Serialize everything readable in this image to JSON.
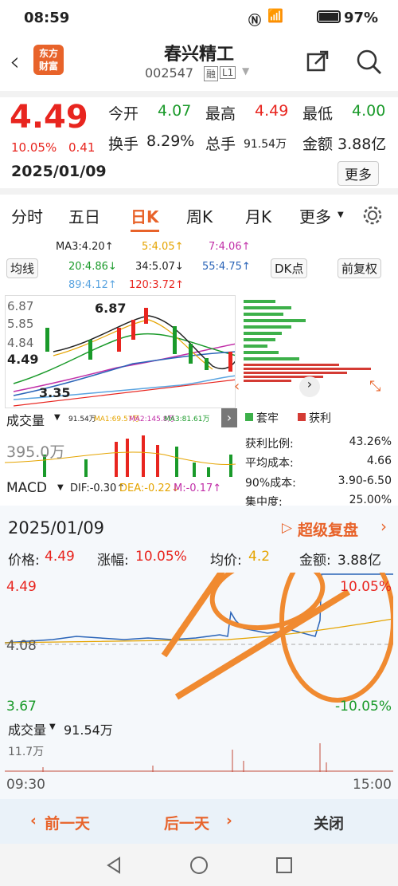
{
  "status": {
    "time": "08:59",
    "battery": "97%"
  },
  "header": {
    "title": "春兴精工",
    "code": "002547",
    "tags": [
      "融",
      "L1"
    ],
    "logo_top": "东方",
    "logo_bottom": "财富"
  },
  "quote": {
    "price": "4.49",
    "change_pct": "10.05%",
    "change": "0.41",
    "date": "2025/01/09",
    "open_label": "今开",
    "open": "4.07",
    "high_label": "最高",
    "high": "4.49",
    "low_label": "最低",
    "low": "4.00",
    "turnover_label": "换手",
    "turnover": "8.29%",
    "volume_label": "总手",
    "volume": "91.54万",
    "amount_label": "金额",
    "amount": "3.88亿",
    "more": "更多"
  },
  "tabs": [
    "分时",
    "五日",
    "日K",
    "周K",
    "月K",
    "更多"
  ],
  "ma": {
    "label": "均线",
    "ma3": "MA3:4.20↑",
    "ma5": "5:4.05↑",
    "ma7": "7:4.06↑",
    "ma20": "20:4.86↓",
    "ma34": "34:5.07↓",
    "ma55": "55:4.75↑",
    "ma89": "89:4.12↑",
    "ma120": "120:3.72↑",
    "dk": "DK点",
    "fuquan": "前复权"
  },
  "kline": {
    "high_marker": "6.87",
    "low_marker": "3.35",
    "price_tag": "4.49",
    "axis": [
      "6.87",
      "5.85",
      "4.84"
    ]
  },
  "volume_bar": {
    "label": "成交量",
    "vol": "91.54万",
    "ma1": "MA1:69.57万",
    "ma2": "MA2:145.8万",
    "ma3": "MA3:81.61万",
    "axis": "395.0万"
  },
  "macd": {
    "label": "MACD",
    "dif": "DIF:-0.30↑",
    "dea": "DEA:-0.22↓",
    "m": "M:-0.17↑"
  },
  "chips": {
    "legend_trapped": "套牢",
    "legend_profit": "获利",
    "rows": [
      {
        "label": "获利比例:",
        "value": "43.26%"
      },
      {
        "label": "平均成本:",
        "value": "4.66"
      },
      {
        "label": "90%成本:",
        "value": "3.90-6.50"
      },
      {
        "label": "集中度:",
        "value": "25.00%"
      }
    ]
  },
  "popup": {
    "date": "2025/01/09",
    "replay": "超级复盘",
    "price_label": "价格:",
    "price": "4.49",
    "pct_label": "涨幅:",
    "pct": "10.05%",
    "avg_label": "均价:",
    "avg": "4.2",
    "amount_label": "金额:",
    "amount": "3.88亿",
    "y_top": "4.49",
    "y_mid": "4.08",
    "y_bot": "3.67",
    "pct_top": "10.05%",
    "pct_bot": "-10.05%",
    "vol_label": "成交量",
    "vol": "91.54万",
    "vol_axis": "11.7万",
    "t_start": "09:30",
    "t_end": "15:00",
    "prev": "前一天",
    "next": "后一天",
    "close": "关闭"
  },
  "colors": {
    "up": "#e8251f",
    "down": "#1a9a2a",
    "accent": "#ff7a1f",
    "blue": "#2a64b8"
  }
}
